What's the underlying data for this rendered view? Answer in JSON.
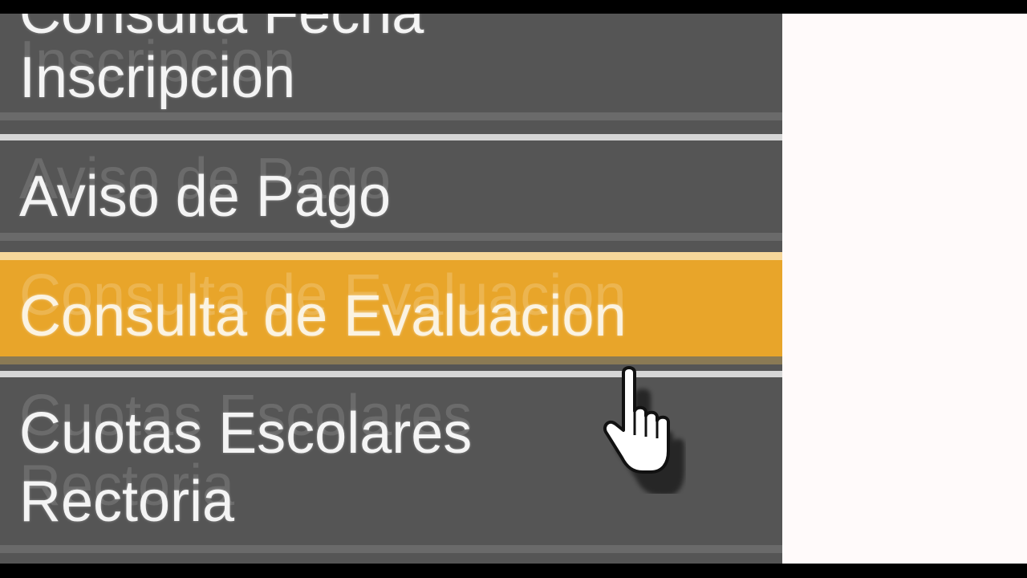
{
  "menu": {
    "items": [
      {
        "label": "Consulta Fecha Inscripcion",
        "line1": "Consulta Fecha",
        "line2": "Inscripcion",
        "active": false
      },
      {
        "label": "Aviso de Pago",
        "active": false
      },
      {
        "label": "Consulta de Evaluacion",
        "active": true
      },
      {
        "label": "Cuotas Escolares Rectoria",
        "line1": "Cuotas Escolares",
        "line2": "Rectoria",
        "active": false
      }
    ]
  },
  "colors": {
    "menu_bg": "#555555",
    "active_bg": "#e8a52a",
    "content_bg": "#fffafa",
    "separator": "#d6d6d6"
  },
  "cursor": {
    "icon": "hand-pointer-icon"
  }
}
